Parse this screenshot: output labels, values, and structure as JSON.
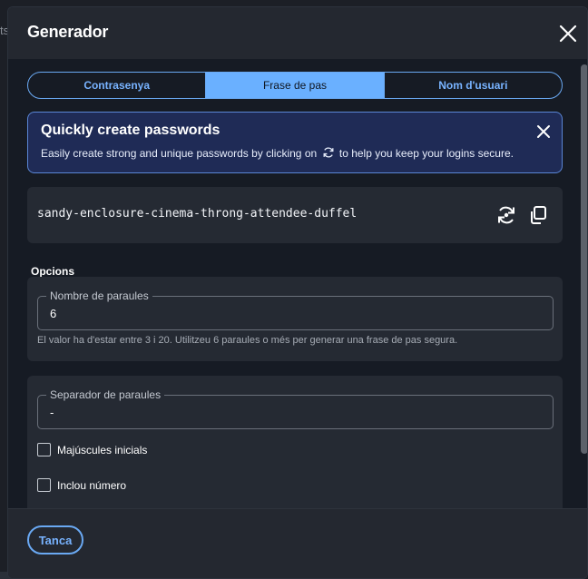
{
  "background": {
    "partial_text": "ts"
  },
  "dialog": {
    "title": "Generador",
    "tabs": [
      {
        "label": "Contrasenya",
        "active": false
      },
      {
        "label": "Frase de pas",
        "active": true
      },
      {
        "label": "Nom d'usuari",
        "active": false
      }
    ],
    "callout": {
      "title": "Quickly create passwords",
      "text_before": "Easily create strong and unique passwords by clicking on",
      "text_after": "to help you keep your logins secure."
    },
    "generated": {
      "value": "sandy-enclosure-cinema-throng-attendee-duffel",
      "icons": [
        "refresh-icon",
        "copy-icon"
      ]
    },
    "options": {
      "label": "Opcions",
      "num_words": {
        "legend": "Nombre de paraules",
        "value": "6",
        "hint": "El valor ha d'estar entre 3 i 20. Utilitzeu 6 paraules o més per generar una frase de pas segura."
      },
      "separator": {
        "legend": "Separador de paraules",
        "value": "-"
      },
      "capitalize": {
        "label": "Majúscules inicials",
        "checked": false
      },
      "include_number": {
        "label": "Inclou número",
        "checked": false
      }
    },
    "footer": {
      "close_label": "Tanca"
    }
  },
  "colors": {
    "accent": "#6ab0ff",
    "callout_bg": "#1f2b56",
    "card_bg": "#252a33",
    "dialog_bg": "#161b24"
  }
}
